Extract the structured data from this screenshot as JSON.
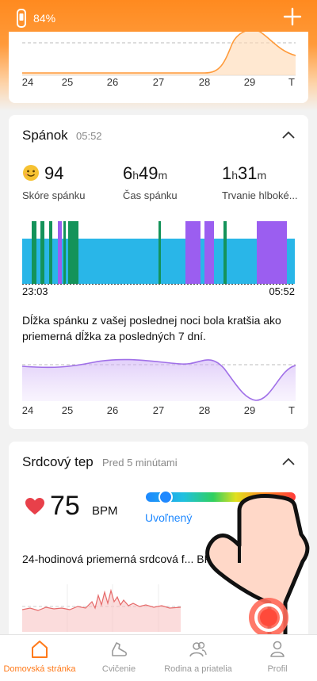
{
  "status": {
    "battery": "84%"
  },
  "top_card": {
    "x_labels": [
      "24",
      "25",
      "26",
      "27",
      "28",
      "29",
      "T"
    ]
  },
  "sleep": {
    "title": "Spánok",
    "time": "05:52",
    "score_value": "94",
    "score_label": "Skóre spánku",
    "duration_h": "6",
    "duration_m": "49",
    "duration_label": "Čas spánku",
    "deep_h": "1",
    "deep_m": "31",
    "deep_label": "Trvanie hlboké...",
    "unit_h": "h",
    "unit_m": "m",
    "start_time": "23:03",
    "end_time": "05:52",
    "note": "Dĺžka spánku z vašej poslednej noci bola kratšia ako priemerná dĺžka za posledných 7 dní.",
    "x_labels": [
      "24",
      "25",
      "26",
      "27",
      "28",
      "29",
      "T"
    ],
    "colors": {
      "light": "#29b6e8",
      "deep": "#14935a",
      "rem": "#9b5ef0"
    }
  },
  "heart": {
    "title": "Srdcový tep",
    "time": "Pred 5 minútami",
    "value": "75",
    "unit": "BPM",
    "zone": "Uvoľnený",
    "avg_label": "24-hodinová priemerná srdcová f... BPM"
  },
  "nav": {
    "items": [
      {
        "label": "Domovská stránka",
        "icon": "home-icon",
        "active": true
      },
      {
        "label": "Cvičenie",
        "icon": "shoe-icon",
        "active": false
      },
      {
        "label": "Rodina a priatelia",
        "icon": "people-icon",
        "active": false
      },
      {
        "label": "Profil",
        "icon": "person-icon",
        "active": false
      }
    ]
  },
  "colors": {
    "accent": "#ff7a1a",
    "heart": "#e8404a",
    "zone": "#1e88ff"
  }
}
